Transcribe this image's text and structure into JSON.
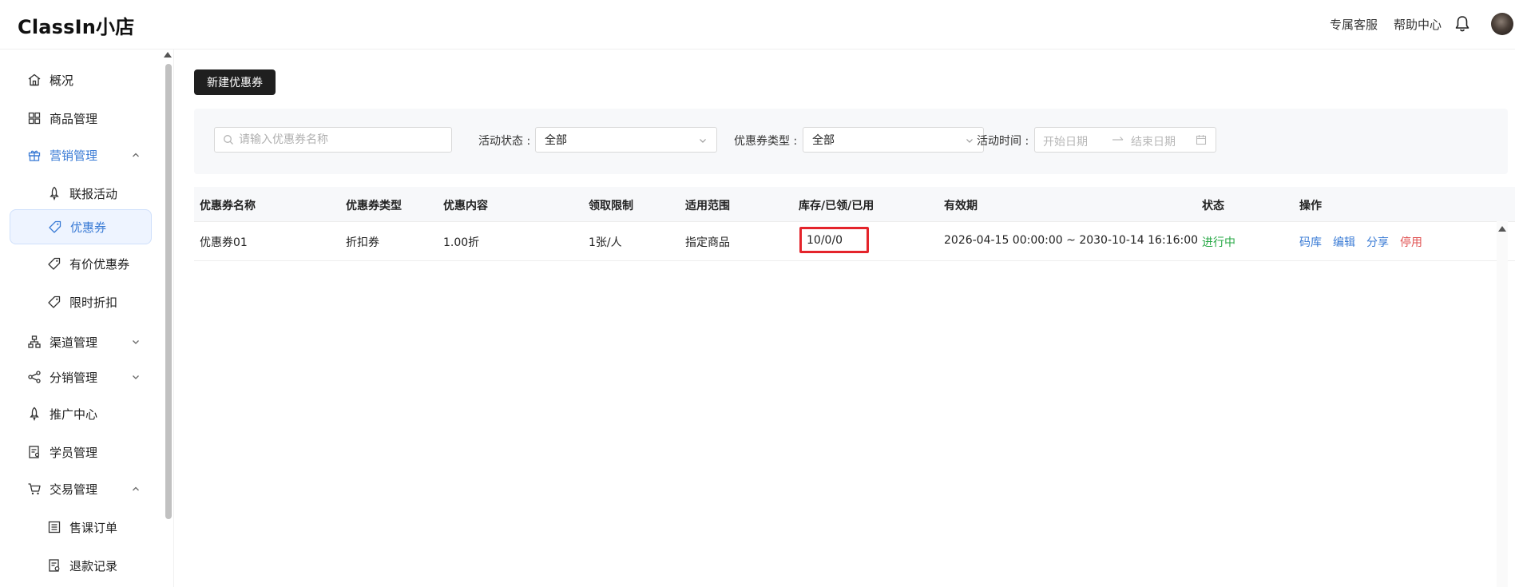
{
  "app": {
    "logo": "ClassIn小店"
  },
  "header": {
    "links": [
      "专属客服",
      "帮助中心"
    ],
    "icons": [
      "bell-icon",
      "avatar"
    ]
  },
  "sidebar": {
    "items": [
      {
        "label": "概况",
        "icon": "home-icon"
      },
      {
        "label": "商品管理",
        "icon": "grid-icon"
      },
      {
        "label": "营销管理",
        "icon": "gift-icon",
        "expanded": true
      },
      {
        "label": "联报活动",
        "icon": "rocket-icon"
      },
      {
        "label": "优惠券",
        "icon": "tag-icon",
        "active": true
      },
      {
        "label": "有价优惠券",
        "icon": "tag-icon"
      },
      {
        "label": "限时折扣",
        "icon": "tag-icon"
      },
      {
        "label": "渠道管理",
        "icon": "sitemap-icon"
      },
      {
        "label": "分销管理",
        "icon": "share-icon"
      },
      {
        "label": "推广中心",
        "icon": "rocket-icon"
      },
      {
        "label": "学员管理",
        "icon": "student-icon"
      },
      {
        "label": "交易管理",
        "icon": "cart-icon",
        "expanded": true
      },
      {
        "label": "售课订单",
        "icon": "list-icon"
      },
      {
        "label": "退款记录",
        "icon": "refund-icon"
      }
    ]
  },
  "toolbar": {
    "new_label": "新建优惠券"
  },
  "filters": {
    "search_placeholder": "请输入优惠券名称",
    "status_label": "活动状态 :",
    "status_value": "全部",
    "type_label": "优惠券类型 :",
    "type_value": "全部",
    "time_label": "活动时间 :",
    "start_placeholder": "开始日期",
    "end_placeholder": "结束日期"
  },
  "table": {
    "headers": [
      "优惠券名称",
      "优惠券类型",
      "优惠内容",
      "领取限制",
      "适用范围",
      "库存/已领/已用",
      "有效期",
      "状态",
      "操作"
    ],
    "rows": [
      {
        "name": "优惠券01",
        "type": "折扣券",
        "content": "1.00折",
        "limit": "1张/人",
        "scope": "指定商品",
        "stock": "10/0/0",
        "validity": "2026-04-15 00:00:00 ~ 2030-10-14 16:16:00",
        "status": "进行中",
        "actions": [
          "码库",
          "编辑",
          "分享",
          "停用"
        ]
      }
    ]
  },
  "colors": {
    "accent": "#3a7bd5",
    "status_active": "#27a845",
    "danger": "#e05252",
    "highlight_box": "#e4242b"
  }
}
